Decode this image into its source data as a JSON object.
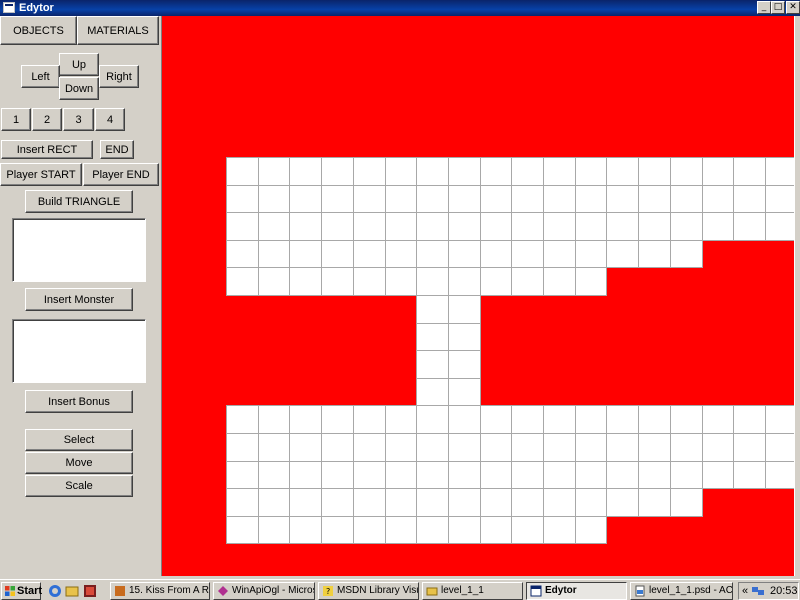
{
  "window": {
    "title": "Edytor",
    "controls": [
      "_",
      "□",
      "✕"
    ]
  },
  "panel": {
    "tabs": {
      "objects": "OBJECTS",
      "materials": "MATERIALS"
    },
    "nav": {
      "up": "Up",
      "left": "Left",
      "right": "Right",
      "down": "Down"
    },
    "layers": [
      "1",
      "2",
      "3",
      "4"
    ],
    "insert_rect": "Insert RECT",
    "end": "END",
    "player_start": "Player START",
    "player_end": "Player END",
    "build_triangle": "Build TRIANGLE",
    "insert_monster": "Insert Monster",
    "insert_bonus": "Insert Bonus",
    "tools": {
      "select": "Select",
      "move": "Move",
      "scale": "Scale"
    }
  },
  "canvas": {
    "background_color": "#ff0000",
    "tile_color": "#ffffff",
    "grid_line_color": "#a8a8a8"
  },
  "taskbar": {
    "start": "Start",
    "tasks": [
      "15. Kiss From A Ro...",
      "WinApiOgl - Micros...",
      "MSDN Library Visu...",
      "level_1_1",
      "Edytor",
      "level_1_1.psd - AC..."
    ],
    "tray_arrow": "«",
    "clock": "20:53"
  }
}
